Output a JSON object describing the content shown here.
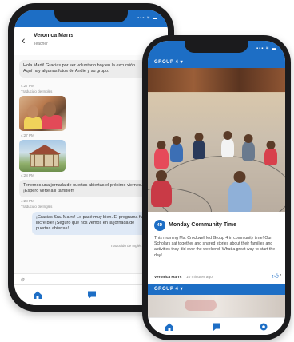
{
  "colors": {
    "accent": "#1d6ec5",
    "bubble": "#ececec",
    "reply_bubble": "#dfe9f6"
  },
  "back_phone": {
    "status_bar": {
      "signal": "▪▪▪ ≈ ▬"
    },
    "header": {
      "back_icon": "chevron-left-icon",
      "name": "Veronica Marrs",
      "role": "Teacher"
    },
    "messages": [
      {
        "text": "Hola Marti! Gracias por ser voluntario hoy en la excursión. Aquí hay algunas fotos de Andie y su grupo."
      },
      {
        "meta": "4:27 PM"
      },
      {
        "meta": "Traducido de Inglés"
      },
      {
        "meta": "4:27 PM"
      },
      {
        "meta": "4:28 PM"
      },
      {
        "text": "Tenemos una jornada de puertas abiertas el próximo viernes. ¡Espero verte allí también!"
      },
      {
        "meta": "4:28 PM"
      },
      {
        "meta": "Traducido de Inglés"
      },
      {
        "text": "¡Gracias Sra. Marrs! Lo pasé muy bien. El programa fue increíble! ¡Seguro que nos vemos en la jornada de puertas abiertas!"
      },
      {
        "meta": "Traducido de Inglés"
      }
    ],
    "composer": {
      "attach_icon": "paperclip-icon"
    },
    "tabs": [
      {
        "icon": "home-icon"
      },
      {
        "icon": "message-icon"
      },
      {
        "icon": "settings-icon"
      }
    ]
  },
  "front_phone": {
    "status_bar": {
      "signal": "▪▪▪ ≈ ▬"
    },
    "group_label": "GROUP 4 ▾",
    "post": {
      "badge": "4D",
      "title": "Monday Community Time",
      "body": "This morning Ms. Crockwell led Group 4 in community time! Our Scholars sat together and shared stories about their families and activities they did over the weekend. What a great way to start the day!",
      "author": "Veronica Marrs",
      "time": "10 minutes ago",
      "likes": "1"
    },
    "second_group_label": "GROUP 4 ▾",
    "tabs": [
      {
        "icon": "home-icon"
      },
      {
        "icon": "message-icon"
      },
      {
        "icon": "settings-icon"
      }
    ]
  }
}
